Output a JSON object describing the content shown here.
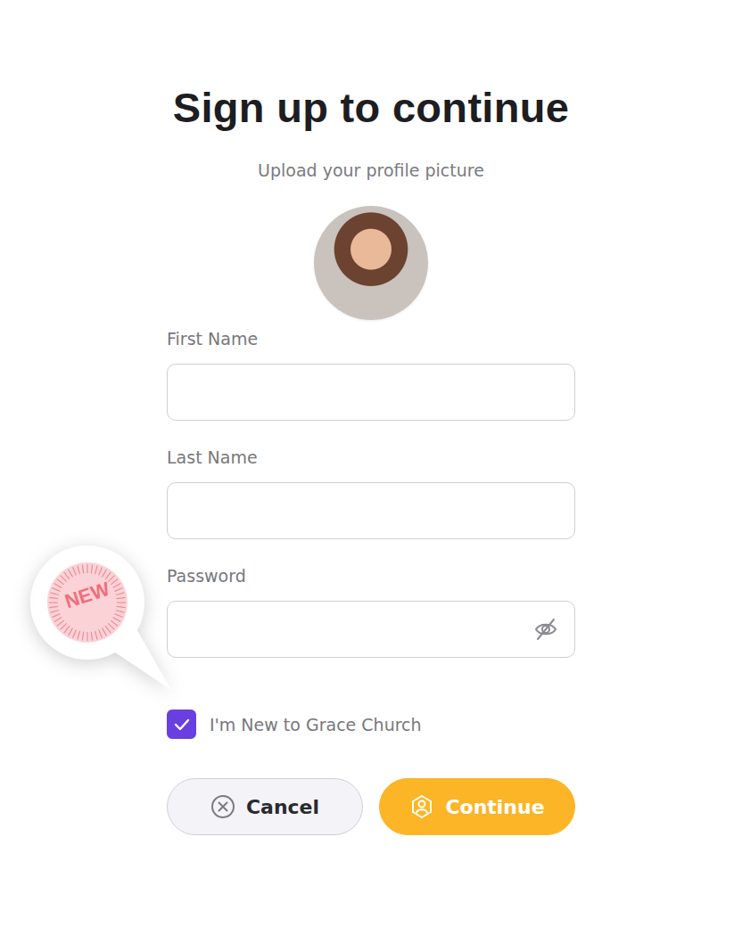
{
  "title": "Sign up to continue",
  "subtitle": "Upload your profile picture",
  "fields": [
    {
      "label": "First Name",
      "kind": "text"
    },
    {
      "label": "Last Name",
      "kind": "text"
    },
    {
      "label": "Password",
      "kind": "password"
    }
  ],
  "checkbox": {
    "label": "I'm New to Grace Church",
    "checked": true
  },
  "badge": {
    "text": "NEW"
  },
  "buttons": [
    {
      "label": "Cancel",
      "kind": "secondary"
    },
    {
      "label": "Continue",
      "kind": "primary"
    }
  ]
}
